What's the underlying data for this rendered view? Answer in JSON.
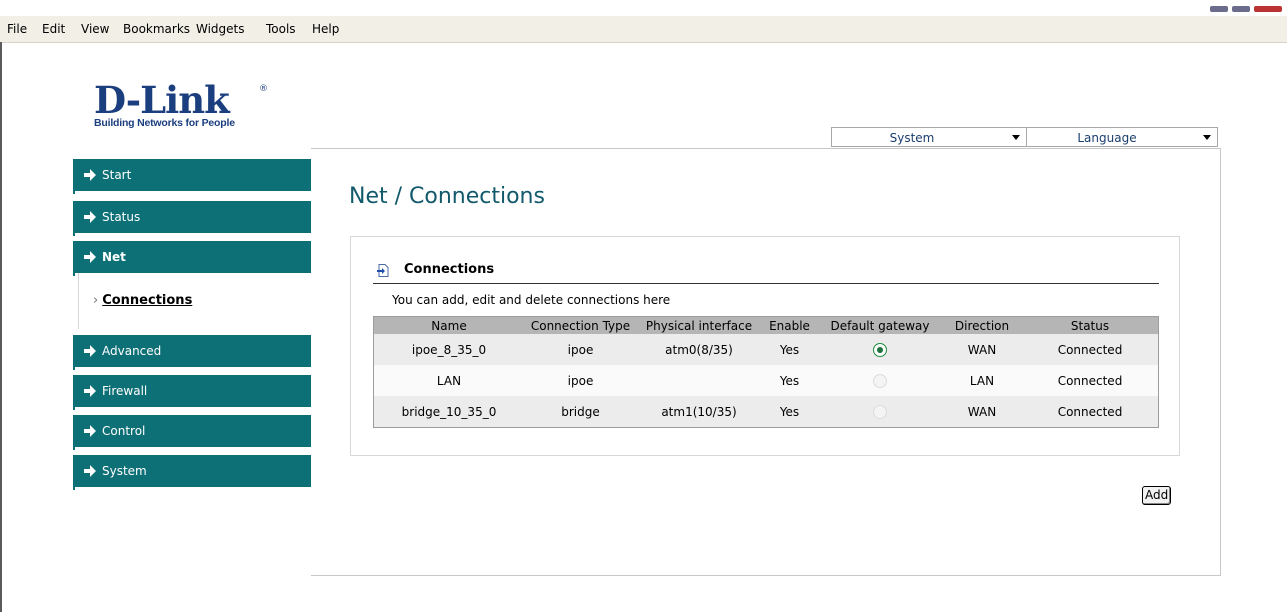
{
  "window": {
    "controls_colors": [
      "#6b6b8b",
      "#6b6b8b",
      "#b33"
    ]
  },
  "menubar": {
    "items": [
      "File",
      "Edit",
      "View",
      "Bookmarks",
      "Widgets",
      "Tools",
      "Help"
    ]
  },
  "logo": {
    "brand": "D-Link",
    "reg": "®",
    "tagline": "Building Networks for People",
    "color": "#1b3e7e"
  },
  "top_selects": {
    "system": "System",
    "language": "Language"
  },
  "sidebar": {
    "accent": "#0e7077",
    "items": [
      {
        "label": "Start"
      },
      {
        "label": "Status"
      },
      {
        "label": "Net"
      },
      {
        "label": "Advanced"
      },
      {
        "label": "Firewall"
      },
      {
        "label": "Control"
      },
      {
        "label": "System"
      }
    ],
    "subitem": "Connections"
  },
  "page": {
    "title": "Net / Connections"
  },
  "connections": {
    "heading": "Connections",
    "description": "You can add, edit and delete connections here",
    "columns": [
      "Name",
      "Connection Type",
      "Physical interface",
      "Enable",
      "Default gateway",
      "Direction",
      "Status"
    ],
    "rows": [
      {
        "name": "ipoe_8_35_0",
        "type": "ipoe",
        "iface": "atm0(8/35)",
        "enable": "Yes",
        "default_gateway": "selected",
        "direction": "WAN",
        "status": "Connected"
      },
      {
        "name": "LAN",
        "type": "ipoe",
        "iface": "",
        "enable": "Yes",
        "default_gateway": "disabled",
        "direction": "LAN",
        "status": "Connected"
      },
      {
        "name": "bridge_10_35_0",
        "type": "bridge",
        "iface": "atm1(10/35)",
        "enable": "Yes",
        "default_gateway": "disabled",
        "direction": "WAN",
        "status": "Connected"
      }
    ],
    "add_label": "Add"
  }
}
